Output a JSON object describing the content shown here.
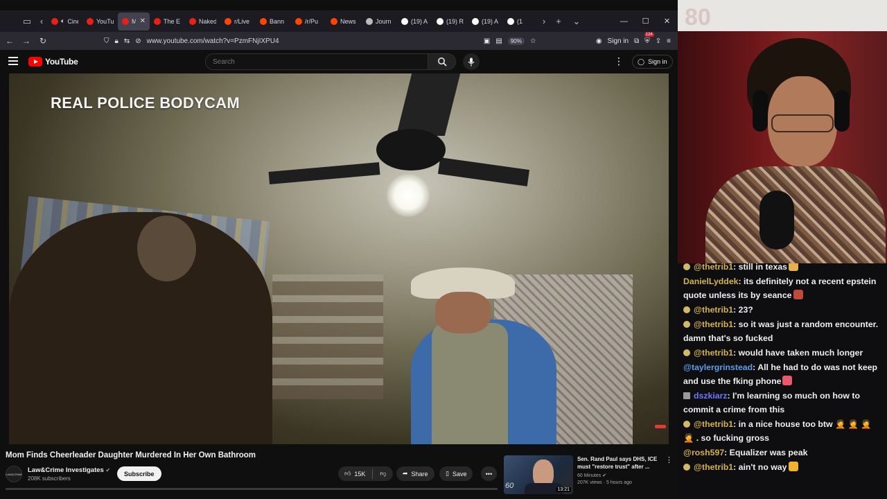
{
  "browser": {
    "tabs": [
      {
        "label": "Cinem",
        "favicon_color": "#e62117",
        "muted": true
      },
      {
        "label": "YouTu",
        "favicon_color": "#e62117"
      },
      {
        "label": "Mo",
        "favicon_color": "#e62117",
        "active": true
      },
      {
        "label": "The E",
        "favicon_color": "#e62117"
      },
      {
        "label": "Naked",
        "favicon_color": "#e62117"
      },
      {
        "label": "r/Live",
        "favicon_color": "#ff4500"
      },
      {
        "label": "Bann",
        "favicon_color": "#ff4500"
      },
      {
        "label": "/r/Pu",
        "favicon_color": "#ff4500"
      },
      {
        "label": "News",
        "favicon_color": "#ff4500"
      },
      {
        "label": "Journ",
        "favicon_color": "#bbbbbb"
      },
      {
        "label": "(19) A",
        "favicon_color": "#ffffff"
      },
      {
        "label": "(19) R",
        "favicon_color": "#ffffff"
      },
      {
        "label": "(19) A",
        "favicon_color": "#ffffff"
      },
      {
        "label": "(1",
        "favicon_color": "#ffffff"
      }
    ],
    "url": "www.youtube.com/watch?v=PzmFNjIXPU4",
    "zoom": "90%",
    "signin_label": "Sign in",
    "extension_badge": "124"
  },
  "youtube": {
    "logo_text": "YouTube",
    "search_placeholder": "Search",
    "signin_label": "Sign in"
  },
  "video": {
    "overlay_title": "REAL POLICE BODYCAM",
    "heading": "Mom Finds Cheerleader Daughter Murdered In Her Own Bathroom",
    "channel_name": "Law&Crime Investigates",
    "channel_avatar_text": "LAW&CRIME",
    "subscribers": "208K subscribers",
    "subscribe_label": "Subscribe",
    "likes": "15K",
    "share_label": "Share",
    "save_label": "Save",
    "progress": 0
  },
  "recommended": {
    "title": "Sen. Rand Paul says DHS, ICE must \"restore trust\" after ...",
    "channel": "60 Minutes",
    "meta": "207K views · 5 hours ago",
    "duration": "13:21",
    "thumb_logo": "60"
  },
  "webcam": {
    "wall_text": "80"
  },
  "chat": {
    "messages": [
      {
        "user": "@thetrib1",
        "user_color": "#d4b24c",
        "text": ": still in texas",
        "emote": "#e8b04a"
      },
      {
        "user": "DanielLyddek",
        "user_color": "#d4b24c",
        "text": ": its definitely not a recent epstein quote unless its by seance",
        "emote": "#c04a3a",
        "badge": "none"
      },
      {
        "user": "@thetrib1",
        "user_color": "#d4b24c",
        "text": ": 23?"
      },
      {
        "user": "@thetrib1",
        "user_color": "#d4b24c",
        "text": ": so it was just a random encounter. damn that's so fucked"
      },
      {
        "user": "@thetrib1",
        "user_color": "#d4b24c",
        "text": ": would have taken much longer"
      },
      {
        "user": "@taylergrinstead",
        "user_color": "#5c9ee6",
        "text": ": All he had to do was not keep and use the fking phone",
        "emote": "#e85a6a",
        "badge": "none"
      },
      {
        "user": "dszkiarz",
        "user_color": "#6a7bff",
        "text": ": I'm learning so much on how to commit a crime from this",
        "badge": "square"
      },
      {
        "user": "@thetrib1",
        "user_color": "#d4b24c",
        "text": ": in a nice house too btw 🤦 🤦 🤦 🤦 . so fucking gross"
      },
      {
        "user": "@rosh597",
        "user_color": "#d4b24c",
        "text": ": Equalizer was peak",
        "badge": "none"
      },
      {
        "user": "@thetrib1",
        "user_color": "#d4b24c",
        "text": ": ain't no way",
        "emote": "#f0b030"
      }
    ]
  }
}
